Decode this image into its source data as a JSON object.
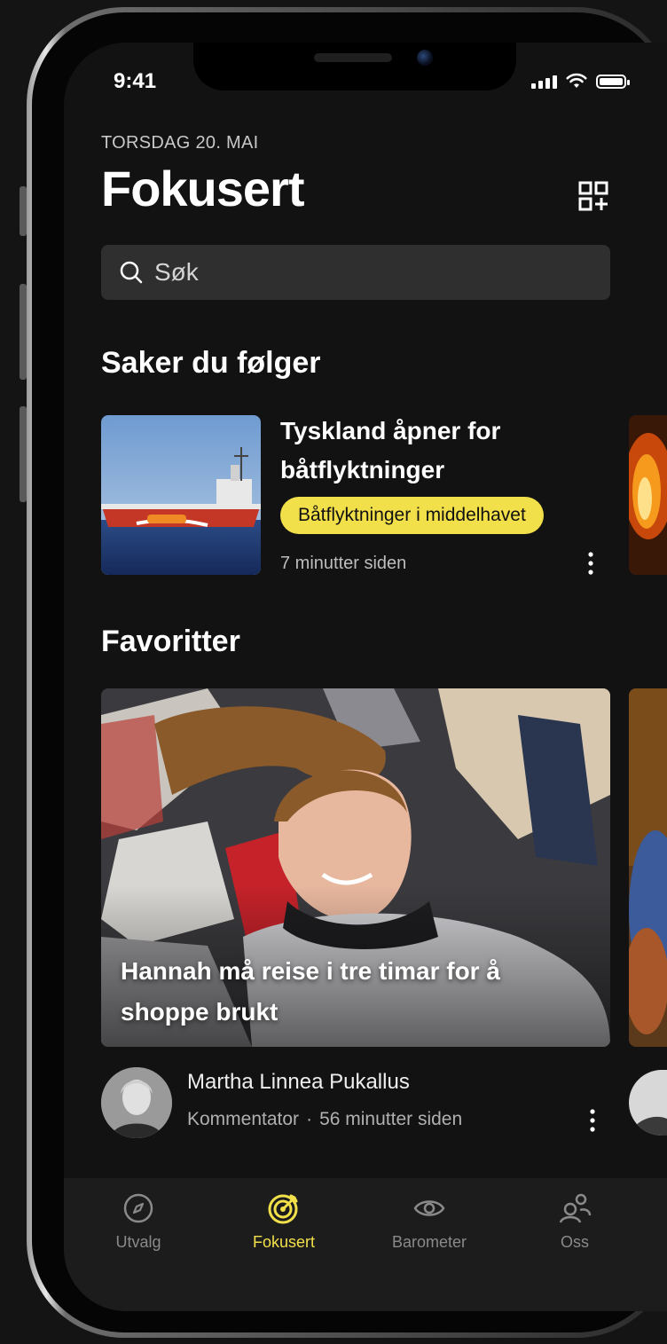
{
  "status_bar": {
    "time": "9:41"
  },
  "header": {
    "date": "TORSDAG 20. MAI",
    "title": "Fokusert",
    "qr_icon": "qr-add-icon"
  },
  "search": {
    "placeholder": "Søk",
    "icon": "search-icon"
  },
  "followed": {
    "section_title": "Saker du følger",
    "items": [
      {
        "headline": "Tyskland åpner for båtflyktninger",
        "tag": "Båtflyktninger i middelhavet",
        "time": "7 minutter siden"
      }
    ]
  },
  "favorites": {
    "section_title": "Favoritter",
    "items": [
      {
        "headline": "Hannah må reise i tre timar for å shoppe brukt",
        "author": "Martha Linnea Pukallus",
        "role": "Kommentator",
        "separator": "·",
        "time": "56 minutter siden"
      }
    ]
  },
  "tabs": [
    {
      "label": "Utvalg",
      "icon": "compass-icon",
      "active": false
    },
    {
      "label": "Fokusert",
      "icon": "target-icon",
      "active": true
    },
    {
      "label": "Barometer",
      "icon": "eye-icon",
      "active": false
    },
    {
      "label": "Oss",
      "icon": "people-icon",
      "active": false
    }
  ],
  "colors": {
    "background": "#121212",
    "accent": "#f2e04a",
    "search_bg": "#2f2f2f",
    "tabbar_bg": "#1c1c1c"
  }
}
